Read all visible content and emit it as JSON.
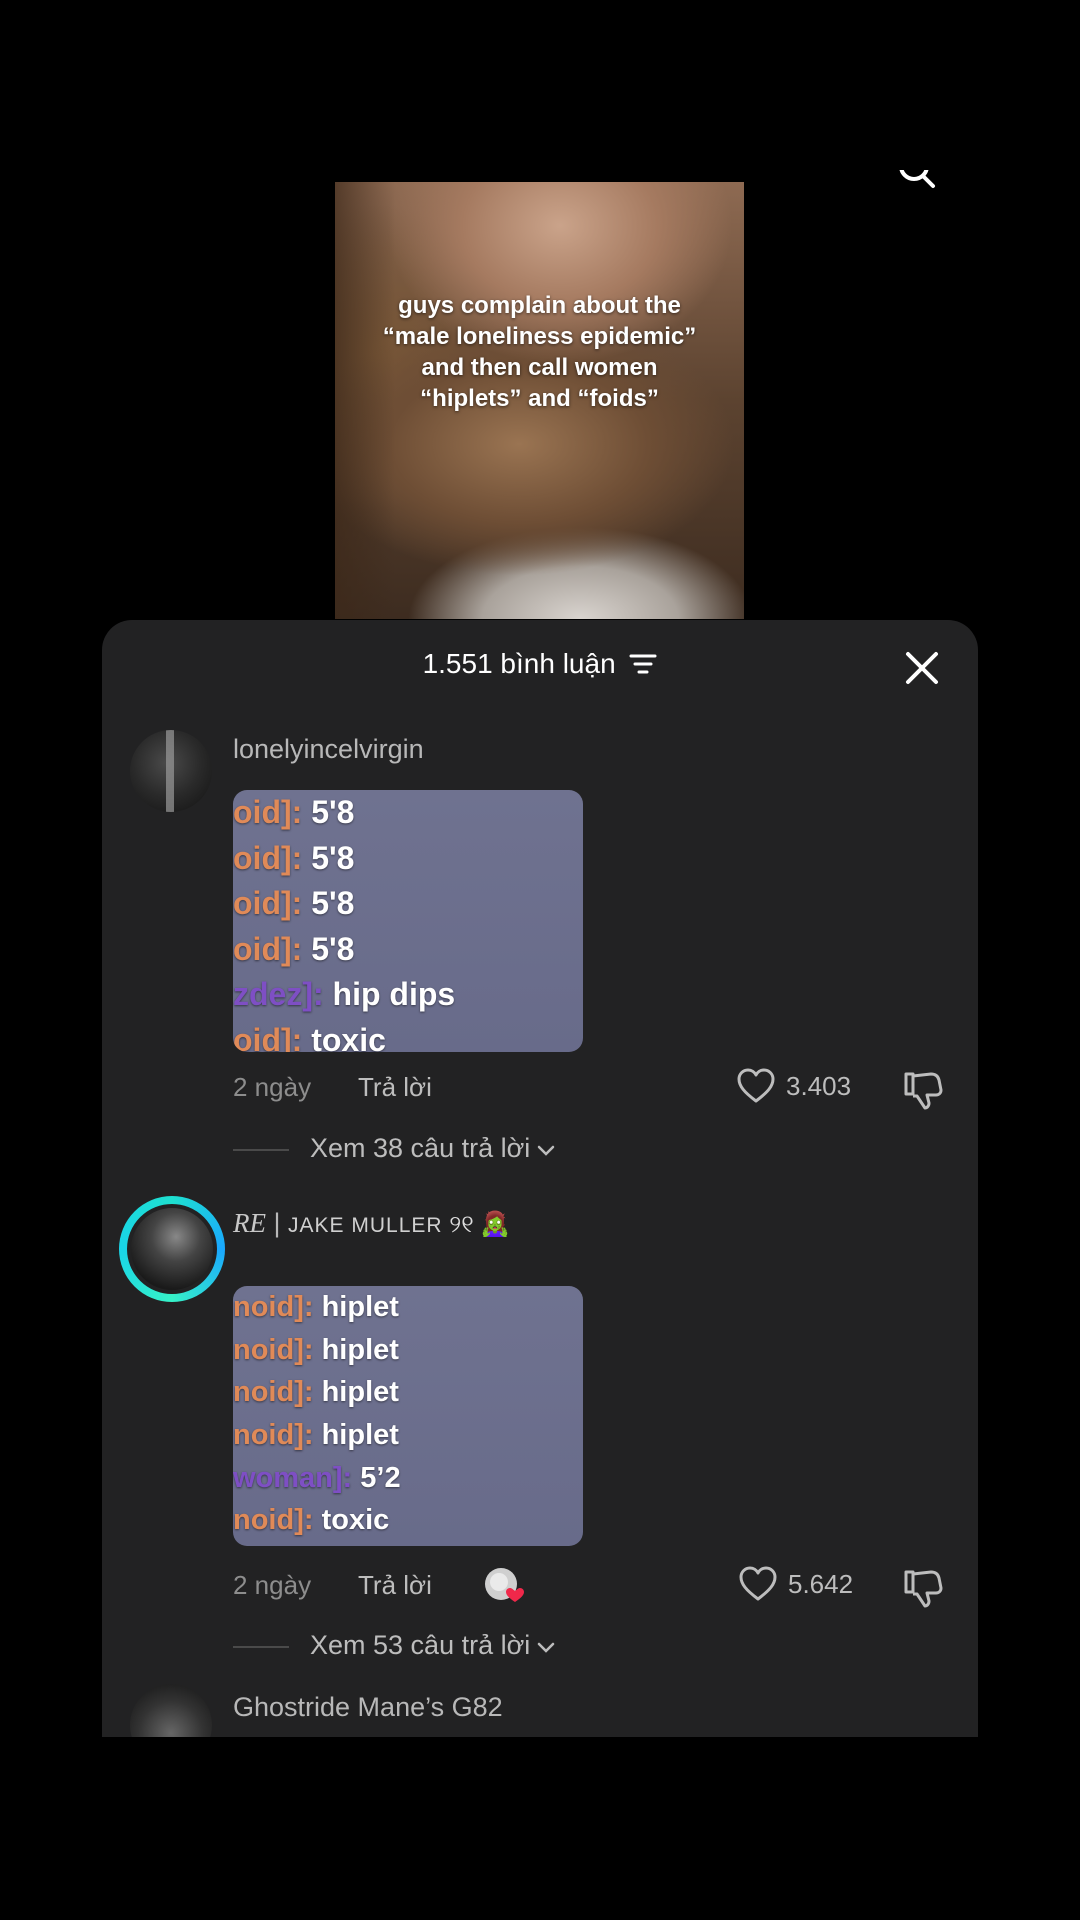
{
  "video": {
    "caption_line1": "guys complain about the",
    "caption_line2": "“male loneliness epidemic”",
    "caption_line3": "and then call women",
    "caption_line4": "“hiplets” and “foids”"
  },
  "sheet": {
    "title": "1.551 bình luận",
    "accent_color": "#1ee0d0",
    "background": "#222223"
  },
  "comments": [
    {
      "username": "lonelyincelvirgin",
      "image_lines": [
        {
          "tag": "oid]: ",
          "msg": "5'8",
          "tag_color": "orange"
        },
        {
          "tag": "oid]: ",
          "msg": "5'8",
          "tag_color": "orange"
        },
        {
          "tag": "oid]: ",
          "msg": "5'8",
          "tag_color": "orange"
        },
        {
          "tag": "oid]: ",
          "msg": "5'8",
          "tag_color": "orange"
        },
        {
          "tag": "zdez]: ",
          "msg": "hip dips",
          "tag_color": "purple"
        },
        {
          "tag": "oid]: ",
          "msg": "toxic",
          "tag_color": "orange"
        }
      ],
      "time": "2 ngày",
      "reply": "Trả lời",
      "likes": "3.403",
      "view_replies": "Xem 38 câu trả lời"
    },
    {
      "username_prefix": "RE",
      "username_sep": " | ",
      "username_name": "JAKE MULLER",
      "username_symbols": " ୨୧ 🧟‍♀️",
      "image_lines": [
        {
          "tag": "noid]: ",
          "msg": "hiplet",
          "tag_color": "orange"
        },
        {
          "tag": "noid]: ",
          "msg": "hiplet",
          "tag_color": "orange"
        },
        {
          "tag": "noid]: ",
          "msg": "hiplet",
          "tag_color": "orange"
        },
        {
          "tag": "noid]: ",
          "msg": "hiplet",
          "tag_color": "orange"
        },
        {
          "tag": "woman]: ",
          "msg": "5’2",
          "tag_color": "purple"
        },
        {
          "tag": "noid]: ",
          "msg": "toxic",
          "tag_color": "orange"
        }
      ],
      "time": "2 ngày",
      "reply": "Trả lời",
      "likes": "5.642",
      "view_replies": "Xem 53 câu trả lời"
    },
    {
      "username": "Ghostride Mane’s G82"
    }
  ]
}
